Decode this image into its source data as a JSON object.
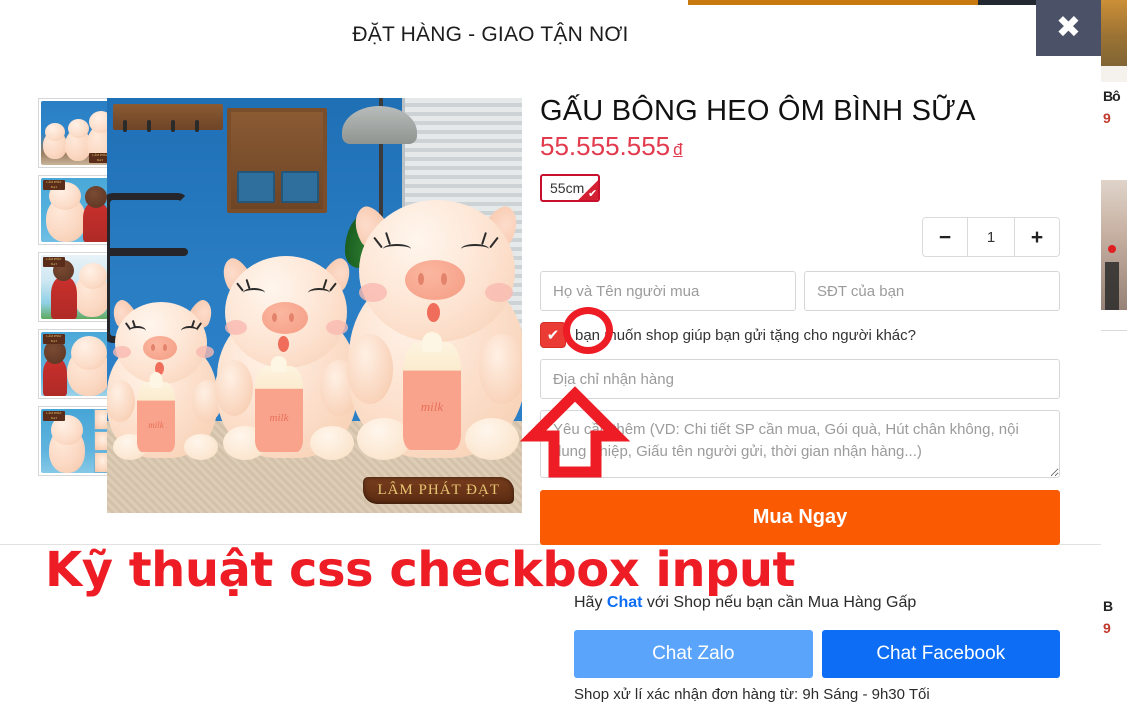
{
  "modal": {
    "title": "ĐẶT HÀNG - GIAO TẬN NƠI",
    "close_icon": "close-x-icon"
  },
  "gallery": {
    "thumbnails": [
      {
        "alt": "Ba chú heo bông ngồi cạnh nhau",
        "watermark": "LÂM PHÁT ĐẠT"
      },
      {
        "alt": "Bé gái ôm heo bông màu hồng",
        "watermark": "LÂM PHÁT ĐẠT"
      },
      {
        "alt": "Bé gái ôm heo bông lớn",
        "watermark": "LÂM PHÁT ĐẠT"
      },
      {
        "alt": "Bé gái ngồi cạnh heo bông",
        "watermark": "LÂM PHÁT ĐẠT"
      },
      {
        "alt": "Heo bông ôm bình sữa",
        "watermark": "LÂM PHÁT ĐẠT"
      }
    ],
    "main_image": {
      "alt": "Ba gấu bông heo ôm bình sữa trên giường",
      "watermark": "LÂM PHÁT ĐẠT",
      "bottle_label": "milk"
    }
  },
  "product": {
    "title": "GẤU BÔNG HEO ÔM BÌNH SỮA",
    "price": "55.555.555",
    "currency": "đ",
    "variants": [
      {
        "label": "55cm",
        "selected": true
      }
    ]
  },
  "quantity": {
    "decrease_label": "−",
    "value": "1",
    "increase_label": "+"
  },
  "form": {
    "name_placeholder": "Họ và Tên người mua",
    "name_value": "",
    "phone_placeholder": "SĐT của bạn",
    "phone_value": "",
    "gift_checkbox": {
      "checked": true,
      "check_glyph": "✔",
      "label": "bạn muốn shop giúp bạn gửi tặng cho người khác?"
    },
    "address_placeholder": "Địa chỉ nhận hàng",
    "address_value": "",
    "note_placeholder": "Yêu cầu thêm (VD: Chi tiết SP cần mua, Gói quà, Hút chân không, nội dung Thiệp, Giấu tên người gửi, thời gian nhận hàng...)",
    "note_value": ""
  },
  "actions": {
    "buy_label": "Mua Ngay",
    "buy_note": "Shop xử lí xác nhận đơn hàng từ: 9h Sáng - 9h30 Tối"
  },
  "chat": {
    "prompt_before": "Hãy ",
    "prompt_link": "Chat",
    "prompt_after": " với Shop nếu bạn cần Mua Hàng Gấp",
    "zalo_label": "Chat Zalo",
    "facebook_label": "Chat Facebook",
    "note": "Shop xử lí xác nhận đơn hàng từ: 9h Sáng - 9h30 Tối"
  },
  "annotation": {
    "caption": "Kỹ thuật css checkbox input",
    "highlight_target": "gift-checkbox"
  },
  "background_page": {
    "line1": "Bô",
    "line2": "9",
    "line3": "B",
    "line4": "9"
  },
  "colors": {
    "accent_orange": "#f95a02",
    "price_red": "#e23b4e",
    "annotation_red": "#ee1c25",
    "checkbox_red": "#ea3b35",
    "zalo_blue": "#5ba4fc",
    "facebook_blue": "#0d6ef5",
    "close_bg": "#4b5268",
    "top_bar_orange": "#c97a0f",
    "top_bar_dark": "#232931"
  }
}
